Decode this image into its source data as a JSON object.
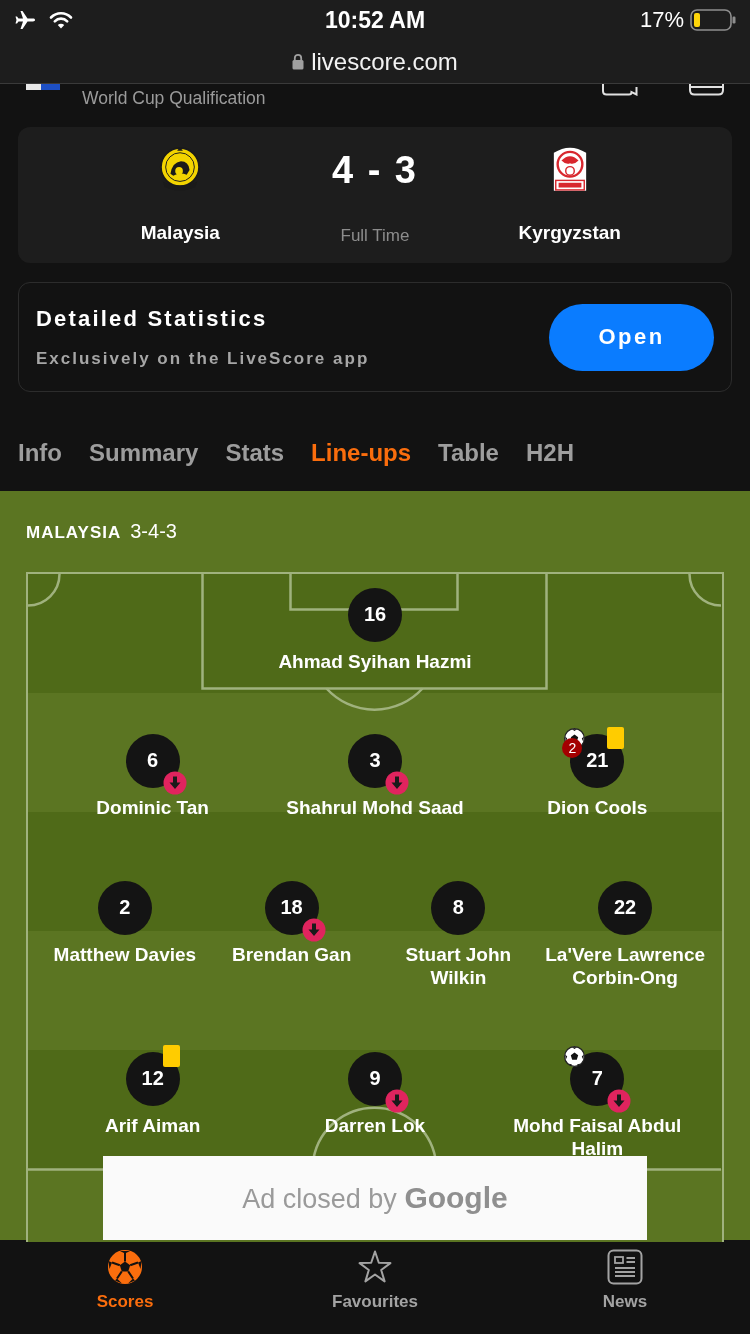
{
  "status_bar": {
    "time": "10:52 AM",
    "battery": "17%"
  },
  "browser": {
    "url": "livescore.com"
  },
  "competition": {
    "name": "World Cup Qualification"
  },
  "match": {
    "home": "Malaysia",
    "score": "4 - 3",
    "status": "Full Time",
    "away": "Kyrgyzstan"
  },
  "promo": {
    "title": "Detailed Statistics",
    "subtitle": "Exclusively on the LiveScore app",
    "button": "Open"
  },
  "tabs": [
    {
      "label": "Info",
      "selected": false
    },
    {
      "label": "Summary",
      "selected": false
    },
    {
      "label": "Stats",
      "selected": false
    },
    {
      "label": "Line-ups",
      "selected": true
    },
    {
      "label": "Table",
      "selected": false
    },
    {
      "label": "H2H",
      "selected": false
    }
  ],
  "lineup": {
    "team": "MALAYSIA",
    "formation": "3-4-3",
    "lines": [
      {
        "players": [
          {
            "number": "16",
            "name": "Ahmad Syihan Hazmi",
            "goal": false,
            "yellow_card": false,
            "subbed_off": false
          }
        ]
      },
      {
        "players": [
          {
            "number": "6",
            "name": "Dominic Tan",
            "goal": false,
            "yellow_card": false,
            "subbed_off": true
          },
          {
            "number": "3",
            "name": "Shahrul Mohd Saad",
            "goal": false,
            "yellow_card": false,
            "subbed_off": true
          },
          {
            "number": "21",
            "name": "Dion Cools",
            "goal": true,
            "goal_count": "2",
            "yellow_card": true,
            "subbed_off": false
          }
        ]
      },
      {
        "players": [
          {
            "number": "2",
            "name": "Matthew Davies",
            "goal": false,
            "yellow_card": false,
            "subbed_off": false
          },
          {
            "number": "18",
            "name": "Brendan Gan",
            "goal": false,
            "yellow_card": false,
            "subbed_off": true
          },
          {
            "number": "8",
            "name": "Stuart John Wilkin",
            "goal": false,
            "yellow_card": false,
            "subbed_off": false
          },
          {
            "number": "22",
            "name": "La'Vere Lawrence Corbin-Ong",
            "goal": false,
            "yellow_card": false,
            "subbed_off": false
          }
        ]
      },
      {
        "players": [
          {
            "number": "12",
            "name": "Arif Aiman",
            "goal": false,
            "yellow_card": true,
            "subbed_off": false
          },
          {
            "number": "9",
            "name": "Darren Lok",
            "goal": false,
            "yellow_card": false,
            "subbed_off": true
          },
          {
            "number": "7",
            "name": "Mohd Faisal Abdul Halim",
            "goal": true,
            "yellow_card": false,
            "subbed_off": true
          }
        ]
      }
    ]
  },
  "ad": {
    "text": "Ad closed by **Google**"
  },
  "bottom_nav": [
    {
      "label": "Scores",
      "kind": "ball",
      "selected": true
    },
    {
      "label": "Favourites",
      "kind": "star",
      "selected": false
    },
    {
      "label": "News",
      "kind": "news",
      "selected": false
    }
  ]
}
